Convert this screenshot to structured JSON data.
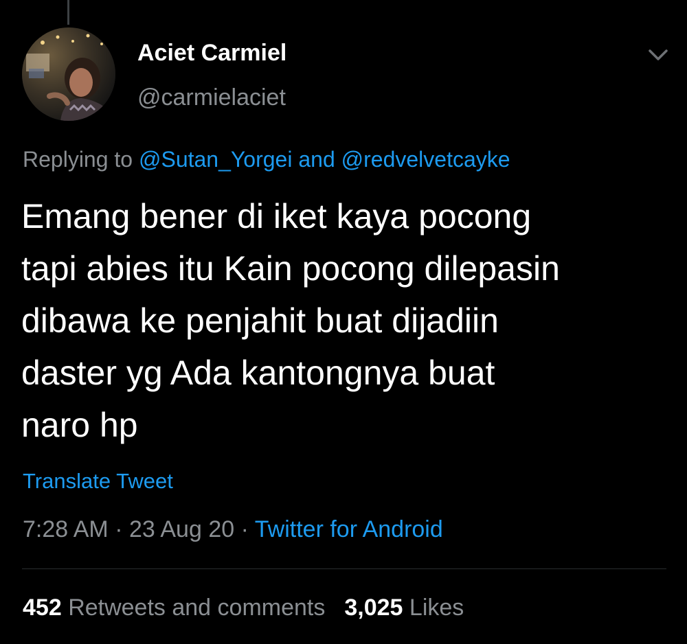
{
  "tweet": {
    "author": {
      "display_name": "Aciet Carmiel",
      "handle": "@carmielaciet"
    },
    "replying": {
      "prefix": "Replying to",
      "mention_1": "@Sutan_Yorgei",
      "joiner": "and",
      "mention_2": "@redvelvetcayke"
    },
    "body_lines": [
      "Emang bener di iket kaya pocong",
      "tapi abies itu Kain pocong dilepasin",
      "dibawa ke penjahit buat dijadiin",
      "daster yg Ada kantongnya buat",
      "naro hp"
    ],
    "translate_label": "Translate Tweet",
    "meta": {
      "time": "7:28 AM",
      "separator": "·",
      "date": "23 Aug 20",
      "source": "Twitter for Android"
    },
    "stats": {
      "retweets_count": "452",
      "retweets_label": "Retweets and comments",
      "likes_count": "3,025",
      "likes_label": "Likes"
    }
  },
  "icons": {
    "more": "chevron-down-icon"
  },
  "colors": {
    "background": "#000000",
    "text_primary": "#ffffff",
    "text_secondary": "#8b8f93",
    "accent": "#1d9bf0"
  }
}
